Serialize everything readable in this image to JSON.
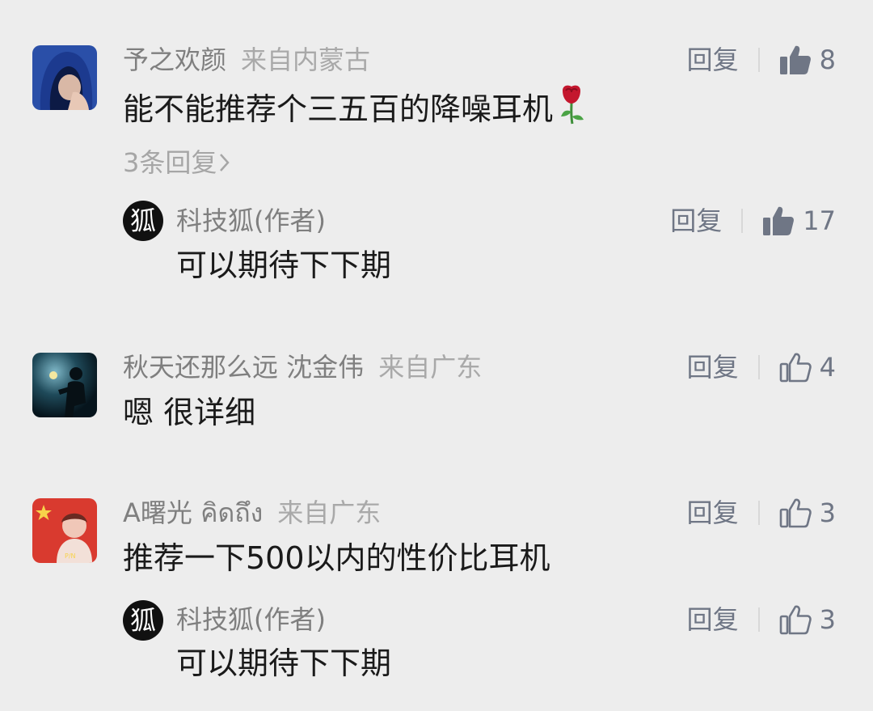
{
  "actions": {
    "reply_label": "回复"
  },
  "comments": [
    {
      "user": "予之欢颜",
      "location": "来自内蒙古",
      "text": "能不能推荐个三五百的降噪耳机",
      "likes": "8",
      "liked": true,
      "more_replies": "3条回复",
      "reply": {
        "author": "科技狐(作者)",
        "avatar_char": "狐",
        "text": "可以期待下下期",
        "likes": "17",
        "liked": true
      }
    },
    {
      "user": "秋天还那么远 沈金伟",
      "location": "来自广东",
      "text": "嗯 很详细",
      "likes": "4",
      "liked": false
    },
    {
      "user": "A曙光 คิดถึง",
      "location": "来自广东",
      "text": "推荐一下500以内的性价比耳机",
      "likes": "3",
      "liked": false,
      "reply": {
        "author": "科技狐(作者)",
        "avatar_char": "狐",
        "text": "可以期待下下期",
        "likes": "3",
        "liked": false
      }
    }
  ],
  "colors": {
    "background": "#ededed",
    "name": "#7f7f7f",
    "location": "#a9a9a9",
    "text": "#1a1a1a",
    "action": "#6f7685"
  }
}
